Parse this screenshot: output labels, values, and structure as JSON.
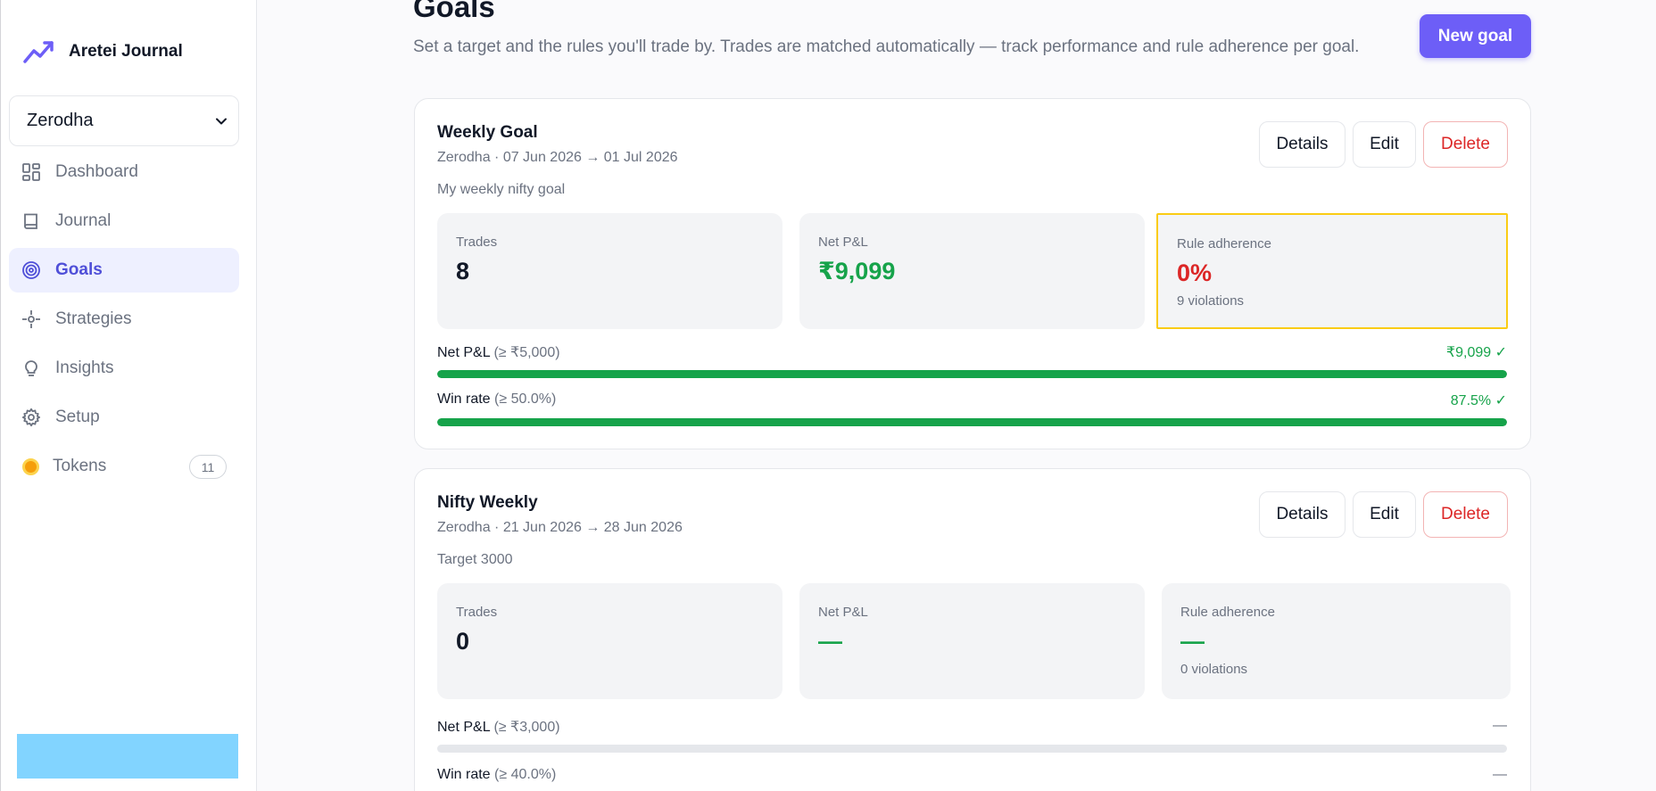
{
  "app": {
    "name": "Aretei Journal"
  },
  "broker_select": {
    "value": "Zerodha"
  },
  "nav": {
    "dashboard": "Dashboard",
    "journal": "Journal",
    "goals": "Goals",
    "strategies": "Strategies",
    "insights": "Insights",
    "setup": "Setup",
    "tokens": "Tokens",
    "tokens_count": "11"
  },
  "header": {
    "title": "Goals",
    "subtitle": "Set a target and the rules you'll trade by. Trades are matched automatically — track performance and rule adherence per goal.",
    "new_goal_label": "New goal"
  },
  "buttons": {
    "details": "Details",
    "edit": "Edit",
    "delete": "Delete"
  },
  "goals": [
    {
      "name": "Weekly Goal",
      "meta": "Zerodha · 07 Jun 2026 → 01 Jul 2026",
      "description": "My weekly nifty goal",
      "stats": {
        "trades_label": "Trades",
        "trades_value": "8",
        "pnl_label": "Net P&L",
        "pnl_value": "₹9,099",
        "adherence_label": "Rule adherence",
        "adherence_value": "0%",
        "violations": "9 violations"
      },
      "progress": [
        {
          "name": "Net P&L",
          "condition": "(≥ ₹5,000)",
          "value": "₹9,099 ✓",
          "fill_percent": 100
        },
        {
          "name": "Win rate",
          "condition": "(≥ 50.0%)",
          "value": "87.5% ✓",
          "fill_percent": 100
        }
      ]
    },
    {
      "name": "Nifty Weekly",
      "meta": "Zerodha · 21 Jun 2026 → 28 Jun 2026",
      "description": "Target 3000",
      "stats": {
        "trades_label": "Trades",
        "trades_value": "0",
        "pnl_label": "Net P&L",
        "pnl_value": "—",
        "adherence_label": "Rule adherence",
        "adherence_value": "—",
        "violations": "0 violations"
      },
      "progress": [
        {
          "name": "Net P&L",
          "condition": "(≥ ₹3,000)",
          "value": "—",
          "fill_percent": 0
        },
        {
          "name": "Win rate",
          "condition": "(≥ 40.0%)",
          "value": "—",
          "fill_percent": 0
        }
      ]
    }
  ],
  "colors": {
    "accent": "#6d5ef7",
    "active_nav": "#4f4fd8",
    "positive": "#16a34a",
    "negative": "#dc2626",
    "highlight_border": "#facc15"
  },
  "icons": {
    "brand": "trend-up-icon",
    "dashboard": "grid-icon",
    "journal": "book-icon",
    "goals": "target-icon",
    "strategies": "crosshair-icon",
    "insights": "lightbulb-icon",
    "setup": "gear-icon",
    "tokens": "coin-icon"
  }
}
